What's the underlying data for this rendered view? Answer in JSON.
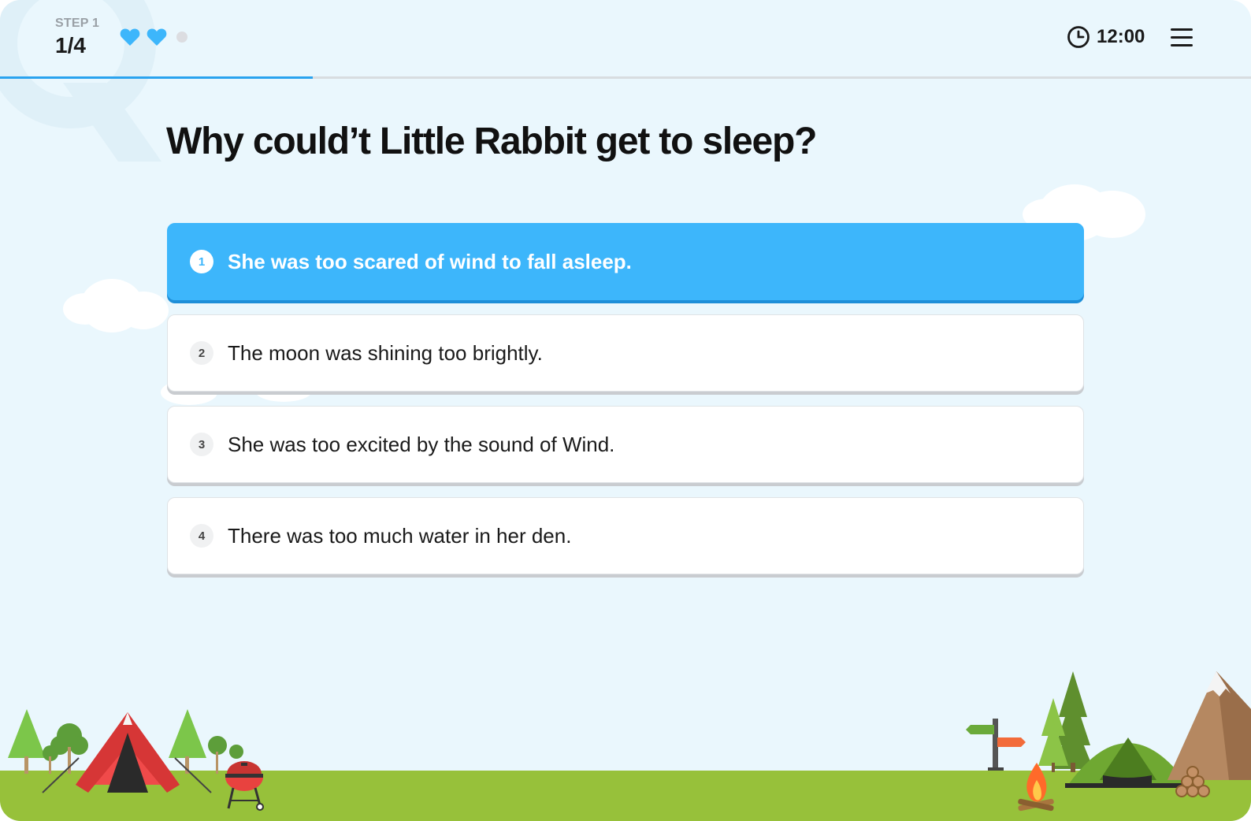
{
  "header": {
    "step_label": "STEP 1",
    "step_count": "1/4",
    "lives": {
      "filled": 2,
      "total": 3
    },
    "progress_fraction": 0.25,
    "timer": "12:00"
  },
  "question": "Why could’t Little Rabbit get to sleep?",
  "options": [
    {
      "number": "1",
      "text": "She was too scared of wind to fall asleep.",
      "selected": true
    },
    {
      "number": "2",
      "text": "The moon was shining too brightly.",
      "selected": false
    },
    {
      "number": "3",
      "text": "She was too excited by the sound of Wind.",
      "selected": false
    },
    {
      "number": "4",
      "text": "There was too much water in her den.",
      "selected": false
    }
  ],
  "colors": {
    "background": "#eaf7fd",
    "accent": "#3db6fb",
    "progress": "#2aa3ef",
    "grass": "#97c13a"
  },
  "icons": [
    "heart-icon",
    "clock-icon",
    "hamburger-menu-icon"
  ]
}
